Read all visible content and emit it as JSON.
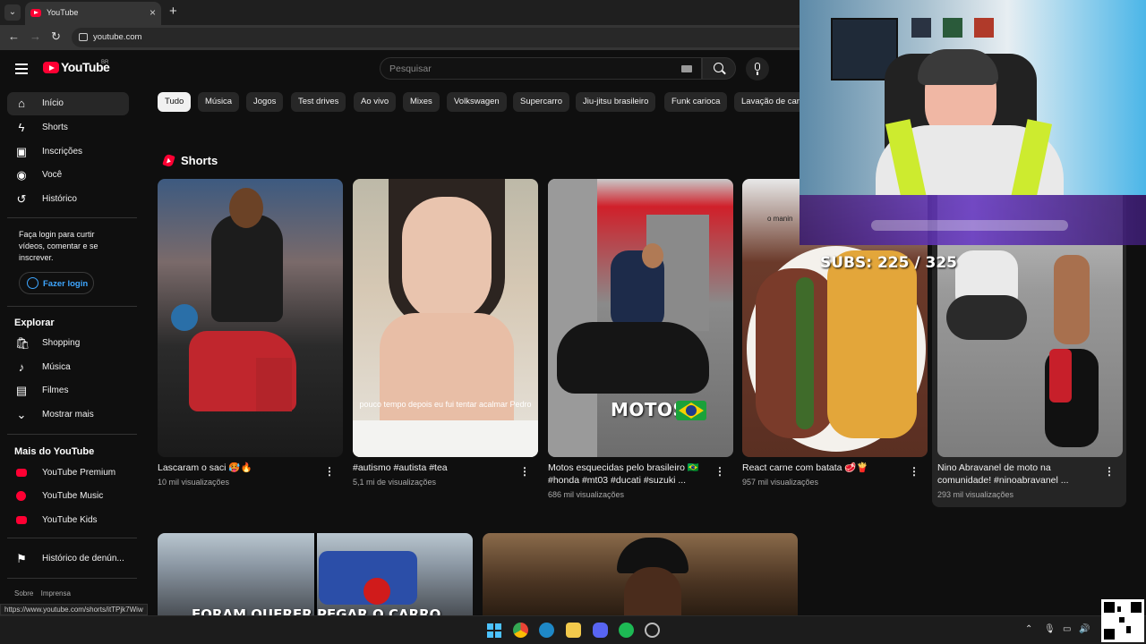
{
  "browser": {
    "tab_title": "YouTube",
    "url": "youtube.com"
  },
  "header": {
    "logo_text": "YouTube",
    "region": "BR",
    "search_placeholder": "Pesquisar"
  },
  "sidebar": {
    "main": [
      {
        "label": "Início",
        "icon": "home-icon"
      },
      {
        "label": "Shorts",
        "icon": "shorts-icon"
      },
      {
        "label": "Inscrições",
        "icon": "subscriptions-icon"
      },
      {
        "label": "Você",
        "icon": "you-icon"
      },
      {
        "label": "Histórico",
        "icon": "history-icon"
      }
    ],
    "login_prompt": "Faça login para curtir vídeos, comentar e se inscrever.",
    "login_button": "Fazer login",
    "explore_heading": "Explorar",
    "explore": [
      {
        "label": "Shopping",
        "icon": "shopping-icon"
      },
      {
        "label": "Música",
        "icon": "music-icon"
      },
      {
        "label": "Filmes",
        "icon": "movies-icon"
      },
      {
        "label": "Mostrar mais",
        "icon": "chevron-down-icon"
      }
    ],
    "more_heading": "Mais do YouTube",
    "more": [
      {
        "label": "YouTube Premium",
        "icon": "youtube-premium-icon"
      },
      {
        "label": "YouTube Music",
        "icon": "youtube-music-icon"
      },
      {
        "label": "YouTube Kids",
        "icon": "youtube-kids-icon"
      }
    ],
    "report_history": "Histórico de denún...",
    "footer": [
      "Sobre",
      "Imprensa"
    ]
  },
  "chips": [
    "Tudo",
    "Música",
    "Jogos",
    "Test drives",
    "Ao vivo",
    "Mixes",
    "Volkswagen",
    "Supercarro",
    "Jiu-jitsu brasileiro",
    "Funk carioca",
    "Lavação de carr"
  ],
  "shorts": {
    "heading": "Shorts",
    "items": [
      {
        "title": "Lascaram o saci 🥵🔥",
        "views": "10 mil visualizações"
      },
      {
        "title": "#autismo #autista #tea",
        "views": "5,1 mi de visualizações",
        "overlay": "pouco tempo depois eu fui tentar acalmar Pedro"
      },
      {
        "title": "Motos esquecidas pelo brasileiro 🇧🇷 #honda #mt03 #ducati #suzuki ...",
        "views": "686 mil visualizações",
        "overlay": "MOTOS"
      },
      {
        "title": "React carne com batata 🥩🍟",
        "views": "957 mil visualizações",
        "overlay": "o manin"
      },
      {
        "title": "Nino Abravanel de moto na comunidade! #ninoabravanel ...",
        "views": "293 mil visualizações"
      }
    ]
  },
  "bottom_row": {
    "overlay_text": "FORAM QUERER PEGAR O CARRO"
  },
  "stream_overlay": {
    "subs": "SUBS: 225 / 325"
  },
  "status_url": "https://www.youtube.com/shorts/itTPjk7Wiw",
  "colors": {
    "accent_red": "#ff0033",
    "link_blue": "#3ea6ff",
    "background": "#0f0f0f"
  }
}
